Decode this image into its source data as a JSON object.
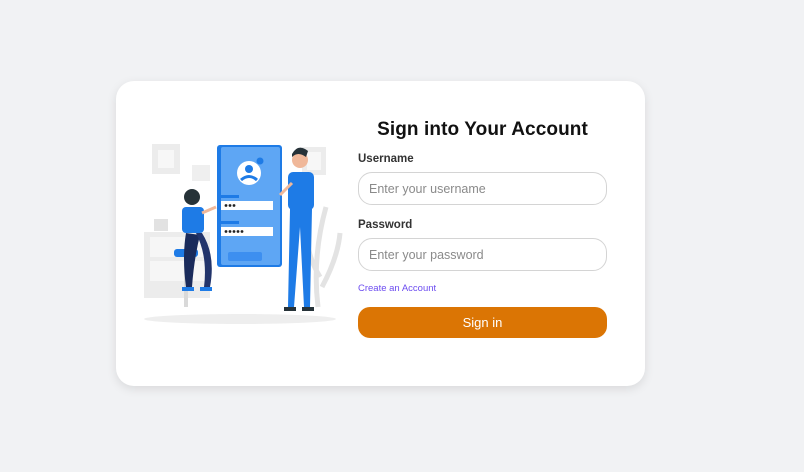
{
  "form": {
    "title": "Sign into Your Account",
    "username_label": "Username",
    "username_placeholder": "Enter your username",
    "username_value": "",
    "password_label": "Password",
    "password_placeholder": "Enter your password",
    "password_value": "",
    "create_account_link": "Create an Account",
    "submit_label": "Sign in"
  },
  "colors": {
    "page_background": "#f1f2f4",
    "card_background": "#ffffff",
    "primary_button": "#db7504",
    "link": "#6c4cf0",
    "illustration_accent": "#1e7be6"
  },
  "illustration": {
    "icon": "login-illustration"
  }
}
